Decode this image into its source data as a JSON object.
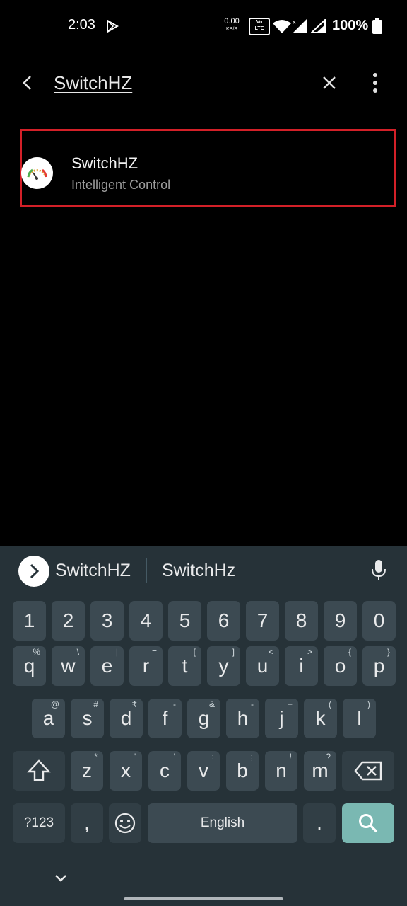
{
  "status_bar": {
    "time": "2:03",
    "net_speed_value": "0.00",
    "net_speed_unit": "KB/S",
    "volte_top": "Vo",
    "volte_mid": "LTE",
    "battery": "100%"
  },
  "search": {
    "query": "SwitchHZ"
  },
  "result": {
    "title": "SwitchHZ",
    "subtitle": "Intelligent Control",
    "highlight_color": "#d32028"
  },
  "keyboard": {
    "suggestions": [
      "SwitchHZ",
      "SwitchHz"
    ],
    "number_row": [
      "1",
      "2",
      "3",
      "4",
      "5",
      "6",
      "7",
      "8",
      "9",
      "0"
    ],
    "row1": [
      {
        "label": "q",
        "hint": "%"
      },
      {
        "label": "w",
        "hint": "\\"
      },
      {
        "label": "e",
        "hint": "|"
      },
      {
        "label": "r",
        "hint": "="
      },
      {
        "label": "t",
        "hint": "["
      },
      {
        "label": "y",
        "hint": "]"
      },
      {
        "label": "u",
        "hint": "<"
      },
      {
        "label": "i",
        "hint": ">"
      },
      {
        "label": "o",
        "hint": "{"
      },
      {
        "label": "p",
        "hint": "}"
      }
    ],
    "row2": [
      {
        "label": "a",
        "hint": "@"
      },
      {
        "label": "s",
        "hint": "#"
      },
      {
        "label": "d",
        "hint": "₹"
      },
      {
        "label": "f",
        "hint": "-"
      },
      {
        "label": "g",
        "hint": "&"
      },
      {
        "label": "h",
        "hint": "-"
      },
      {
        "label": "j",
        "hint": "+"
      },
      {
        "label": "k",
        "hint": "("
      },
      {
        "label": "l",
        "hint": ")"
      }
    ],
    "row3": [
      {
        "label": "z",
        "hint": "*"
      },
      {
        "label": "x",
        "hint": "\""
      },
      {
        "label": "c",
        "hint": "'"
      },
      {
        "label": "v",
        "hint": ":"
      },
      {
        "label": "b",
        "hint": ";"
      },
      {
        "label": "n",
        "hint": "!"
      },
      {
        "label": "m",
        "hint": "?"
      }
    ],
    "symbols_label": "?123",
    "comma_label": ",",
    "space_label": "English",
    "period_label": ".",
    "enter_color": "#7ab8b2"
  }
}
